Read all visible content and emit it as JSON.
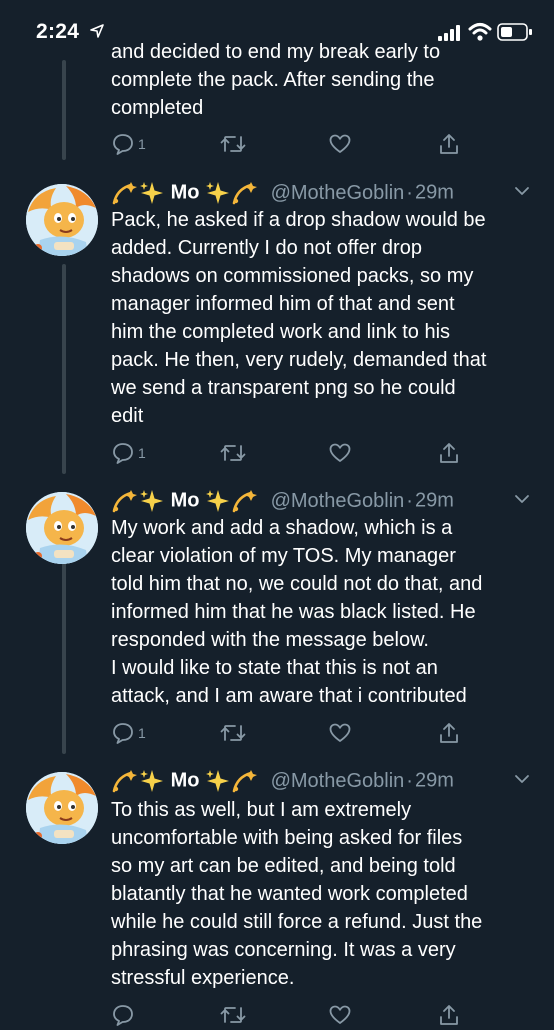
{
  "status_bar": {
    "time": "2:24"
  },
  "tweets": [
    {
      "text_visible": "and decided to end my break early to\ncomplete the pack. After sending the\ncompleted",
      "reply_count": "1"
    },
    {
      "name": "Mo",
      "handle": "@MotheGoblin",
      "separator": "·",
      "time_ago": "29m",
      "text": "Pack, he asked if a drop shadow would be\nadded. Currently I do not offer drop\nshadows on commissioned packs, so my\nmanager informed him of that and sent\nhim the completed work and link to his\npack. He then, very rudely, demanded that\nwe send a transparent png so he could\nedit",
      "reply_count": "1"
    },
    {
      "name": "Mo",
      "handle": "@MotheGoblin",
      "separator": "·",
      "time_ago": "29m",
      "text": "My work and add a shadow, which is a\nclear violation of my TOS. My manager\ntold him that no, we could not do that, and\ninformed him that he was black listed. He\nresponded with the message below.\nI would like to state that this is not an\nattack, and I am aware that i contributed",
      "reply_count": "1"
    },
    {
      "name": "Mo",
      "handle": "@MotheGoblin",
      "separator": "·",
      "time_ago": "29m",
      "text": "To this as well, but I am extremely\nuncomfortable with being asked for files\nso my art can be edited, and being told\nblatantly that he wanted work completed\nwhile he could still force a refund. Just the\nphrasing was concerning. It was a very\nstressful experience.",
      "reply_count": ""
    }
  ],
  "colors": {
    "background": "#15202b",
    "secondary_text": "#8899a6",
    "thread_line": "#38444d",
    "text": "#ffffff"
  },
  "icons": [
    "location-arrow-icon",
    "signal-icon",
    "wifi-icon",
    "battery-icon",
    "sparkles-icon",
    "shooting-star-icon",
    "chevron-down-icon",
    "reply-icon",
    "retweet-icon",
    "like-icon",
    "share-icon"
  ]
}
